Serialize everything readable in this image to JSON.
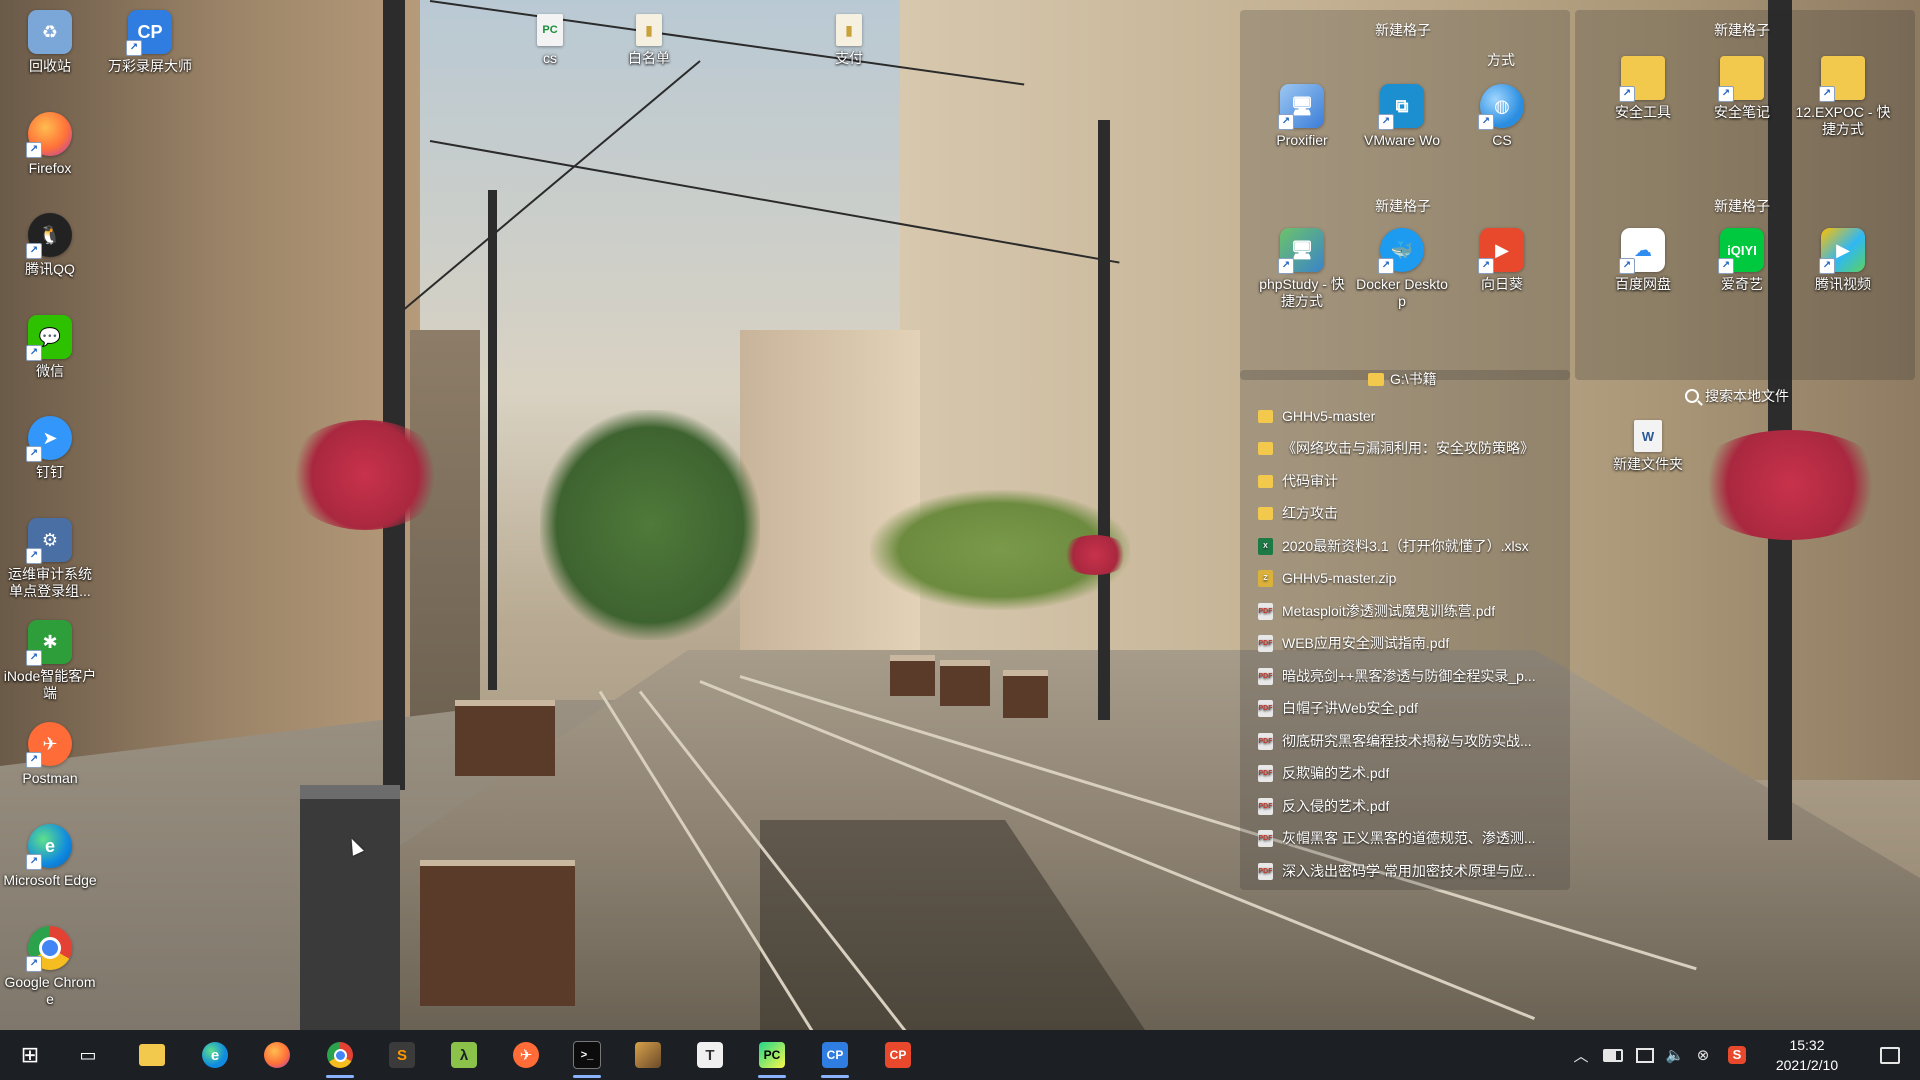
{
  "desktop": {
    "left_icons": [
      {
        "label": "回收站",
        "icon": "recycle-bin-icon",
        "color": "#7aa7d8"
      },
      {
        "label": "万彩录屏大师",
        "icon": "screen-recorder-icon",
        "color": "#2f7de1"
      },
      {
        "label": "Firefox",
        "icon": "firefox-icon",
        "color": "#ff7139"
      },
      {
        "label": "腾讯QQ",
        "icon": "qq-icon",
        "color": "#222222"
      },
      {
        "label": "微信",
        "icon": "wechat-icon",
        "color": "#2dc100"
      },
      {
        "label": "钉钉",
        "icon": "dingtalk-icon",
        "color": "#3296fa"
      },
      {
        "label": "运维审计系统单点登录组...",
        "icon": "audit-system-icon",
        "color": "#4a6fa5"
      },
      {
        "label": "iNode智能客户端",
        "icon": "inode-icon",
        "color": "#2e9e3a"
      },
      {
        "label": "Postman",
        "icon": "postman-icon",
        "color": "#ff6c37"
      },
      {
        "label": "Microsoft Edge",
        "icon": "edge-icon",
        "color": "#0f8ae0"
      },
      {
        "label": "Google Chrome",
        "icon": "chrome-icon",
        "color": "#e34133"
      }
    ],
    "top_files": [
      {
        "label": "cs",
        "icon": "file-cs-icon"
      },
      {
        "label": "白名单",
        "icon": "file-whitelist-icon"
      },
      {
        "label": "支付",
        "icon": "file-payment-icon"
      }
    ],
    "fences": {
      "group1_title": "新建格子",
      "group1_subtitle": "方式",
      "group2_title": "新建格子",
      "group3_title": "新建格子",
      "group4_title": "新建格子",
      "group1_icons": [
        {
          "label": "Proxifier",
          "icon": "proxifier-icon",
          "color": "#3b7dd8"
        },
        {
          "label": "VMware Wo",
          "icon": "vmware-icon",
          "color": "#1b8fd0"
        },
        {
          "label": "CS",
          "icon": "cs-globe-icon",
          "color": "#2a8de0"
        }
      ],
      "group2_icons": [
        {
          "label": "安全工具",
          "icon": "folder-icon",
          "color": "#f2c94c"
        },
        {
          "label": "安全笔记",
          "icon": "folder-icon",
          "color": "#f2c94c"
        },
        {
          "label": "12.EXPOC - 快捷方式",
          "icon": "folder-icon",
          "color": "#f2c94c"
        }
      ],
      "group3_icons": [
        {
          "label": "phpStudy - 快捷方式",
          "icon": "phpstudy-icon",
          "color": "#3a83c9"
        },
        {
          "label": "Docker Desktop",
          "icon": "docker-icon",
          "color": "#1d9bf0"
        },
        {
          "label": "向日葵",
          "icon": "sunlogin-icon",
          "color": "#e8492c"
        }
      ],
      "group4_icons": [
        {
          "label": "百度网盘",
          "icon": "baidu-netdisk-icon",
          "color": "#ffffff"
        },
        {
          "label": "爱奇艺",
          "icon": "iqiyi-icon",
          "color": "#00c940"
        },
        {
          "label": "腾讯视频",
          "icon": "tencent-video-icon",
          "color": "#2fb8f5"
        }
      ]
    },
    "file_panel": {
      "path": "G:\\书籍",
      "search_label": "搜索本地文件",
      "new_folder_label": "新建文件夹",
      "items": [
        {
          "name": "GHHv5-master",
          "type": "folder"
        },
        {
          "name": "《网络攻击与漏洞利用：安全攻防策略》",
          "type": "folder"
        },
        {
          "name": "代码审计",
          "type": "folder"
        },
        {
          "name": "红方攻击",
          "type": "folder"
        },
        {
          "name": "2020最新资料3.1（打开你就懂了）.xlsx",
          "type": "xlsx"
        },
        {
          "name": "GHHv5-master.zip",
          "type": "zip"
        },
        {
          "name": "Metasploit渗透测试魔鬼训练营.pdf",
          "type": "pdf"
        },
        {
          "name": "WEB应用安全测试指南.pdf",
          "type": "pdf"
        },
        {
          "name": "暗战亮剑++黑客渗透与防御全程实录_p...",
          "type": "pdf"
        },
        {
          "name": "白帽子讲Web安全.pdf",
          "type": "pdf"
        },
        {
          "name": "彻底研究黑客编程技术揭秘与攻防实战...",
          "type": "pdf"
        },
        {
          "name": "反欺骗的艺术.pdf",
          "type": "pdf"
        },
        {
          "name": "反入侵的艺术.pdf",
          "type": "pdf"
        },
        {
          "name": "灰帽黑客 正义黑客的道德规范、渗透测...",
          "type": "pdf"
        },
        {
          "name": "深入浅出密码学 常用加密技术原理与应...",
          "type": "pdf"
        }
      ]
    }
  },
  "taskbar": {
    "apps": [
      {
        "name": "start",
        "icon": "windows-start-icon",
        "glyph": "⊞",
        "color": "#ffffff"
      },
      {
        "name": "task-view",
        "icon": "task-view-icon",
        "glyph": "▭",
        "color": "#ffffff"
      },
      {
        "name": "file-explorer",
        "icon": "file-explorer-icon",
        "glyph": "",
        "color": "#f2c94c"
      },
      {
        "name": "edge",
        "icon": "edge-icon",
        "glyph": "e",
        "color": "#0f8ae0"
      },
      {
        "name": "firefox",
        "icon": "firefox-icon",
        "glyph": "",
        "color": "#ff7139"
      },
      {
        "name": "chrome",
        "icon": "chrome-icon",
        "glyph": "",
        "color": "#e34133"
      },
      {
        "name": "sublime-text",
        "icon": "sublime-text-icon",
        "glyph": "S",
        "color": "#ff9800"
      },
      {
        "name": "burp-lambda",
        "icon": "lambda-icon",
        "glyph": "λ",
        "color": "#8bc34a"
      },
      {
        "name": "postman",
        "icon": "postman-icon",
        "glyph": "",
        "color": "#ff6c37"
      },
      {
        "name": "terminal",
        "icon": "terminal-icon",
        "glyph": ">_",
        "color": "#333333"
      },
      {
        "name": "photo-app",
        "icon": "photo-viewer-icon",
        "glyph": "",
        "color": "#6b4a2a"
      },
      {
        "name": "typora",
        "icon": "typora-icon",
        "glyph": "T",
        "color": "#f0f0f0"
      },
      {
        "name": "pycharm",
        "icon": "pycharm-icon",
        "glyph": "PC",
        "color": "#21d789"
      },
      {
        "name": "screen-recorder",
        "icon": "screen-recorder-icon",
        "glyph": "CP",
        "color": "#2f7de1"
      },
      {
        "name": "presenter",
        "icon": "presenter-icon",
        "glyph": "CP",
        "color": "#e8492c"
      }
    ],
    "tray": [
      {
        "icon": "chevron-up-icon",
        "glyph": "︿"
      },
      {
        "icon": "battery-icon",
        "glyph": "▭"
      },
      {
        "icon": "network-icon",
        "glyph": "▣"
      },
      {
        "icon": "volume-icon",
        "glyph": "🔈"
      },
      {
        "icon": "close-circle-icon",
        "glyph": "⊗"
      },
      {
        "icon": "sogou-ime-icon",
        "glyph": "S"
      }
    ],
    "time": "15:32",
    "date": "2021/2/10",
    "notification_icon": "notification-icon"
  }
}
